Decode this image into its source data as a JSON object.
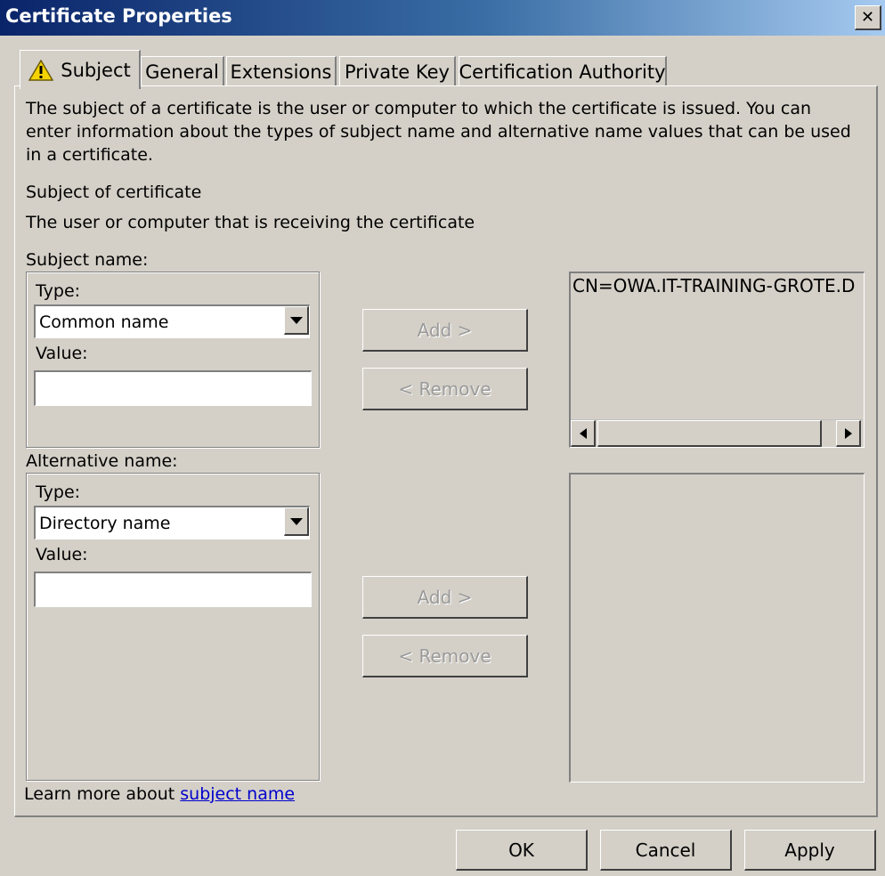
{
  "window": {
    "title": "Certificate Properties",
    "close_glyph": "✕"
  },
  "tabs": [
    {
      "label": "Subject",
      "icon": "warning-icon",
      "active": true
    },
    {
      "label": "General"
    },
    {
      "label": "Extensions"
    },
    {
      "label": "Private Key"
    },
    {
      "label": "Certification Authority"
    }
  ],
  "subject_tab": {
    "intro_line1": "The subject of a certificate is the user or computer to which the certificate is issued. You can",
    "intro_line2": "enter information about the types of subject name and alternative name values that can be used",
    "intro_line3": "in a certificate.",
    "subject_heading": "Subject of certificate",
    "subject_desc": "The user or computer that is receiving the certificate",
    "subject_name": {
      "label": "Subject name:",
      "type_label": "Type:",
      "type_value": "Common name",
      "value_label": "Value:",
      "value": "",
      "add_label": "Add >",
      "remove_label": "< Remove",
      "list_items": [
        "CN=OWA.IT-TRAINING-GROTE.D"
      ]
    },
    "alternative_name": {
      "label": "Alternative name:",
      "type_label": "Type:",
      "type_value": "Directory name",
      "value_label": "Value:",
      "value": "",
      "add_label": "Add >",
      "remove_label": "< Remove",
      "list_items": []
    },
    "learn_more_prefix": "Learn more about ",
    "learn_more_link": "subject name"
  },
  "footer": {
    "ok_label": "OK",
    "cancel_label": "Cancel",
    "apply_label": "Apply"
  }
}
